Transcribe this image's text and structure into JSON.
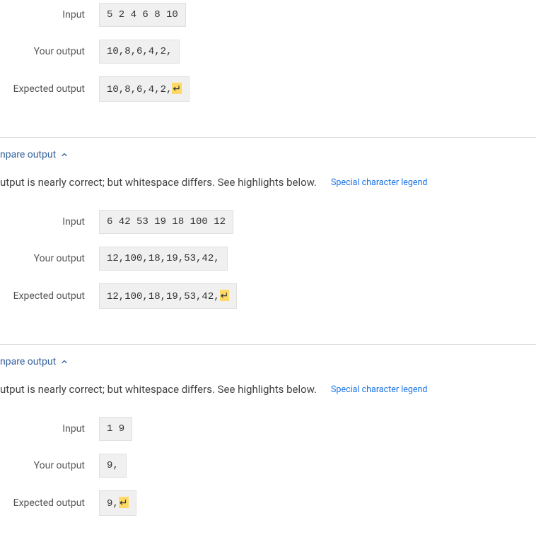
{
  "labels": {
    "input": "Input",
    "your_output": "Your output",
    "expected_output": "Expected output"
  },
  "compare_output_label": "npare output",
  "message_prefix": "utput is nearly correct; but whitespace differs. See highlights below.",
  "legend_link": "Special character legend",
  "return_char": "↵",
  "cases": [
    {
      "input": "5 2 4 6 8 10",
      "your_output": "10,8,6,4,2,",
      "expected_output": "10,8,6,4,2,",
      "expected_highlight_suffix": true,
      "show_header": false
    },
    {
      "input": "6 42 53 19 18 100 12",
      "your_output": "12,100,18,19,53,42,",
      "expected_output": "12,100,18,19,53,42,",
      "expected_highlight_suffix": true,
      "show_header": true
    },
    {
      "input": "1 9",
      "your_output": "9,",
      "expected_output": "9,",
      "expected_highlight_suffix": true,
      "show_header": true
    }
  ]
}
